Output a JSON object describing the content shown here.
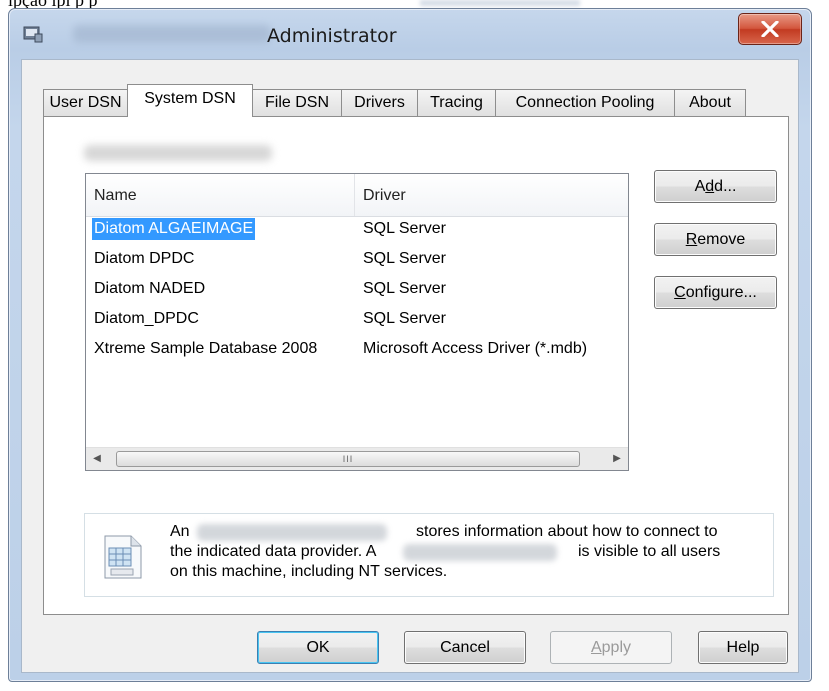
{
  "top_strip_text": "ı̂pção ipl̂ p p̂",
  "window": {
    "title_suffix": "Administrator",
    "close_icon": "close-x-icon",
    "app_icon": "odbc-app-icon"
  },
  "tabs": [
    {
      "label": "User DSN",
      "active": false
    },
    {
      "label": "System DSN",
      "active": true
    },
    {
      "label": "File DSN",
      "active": false
    },
    {
      "label": "Drivers",
      "active": false
    },
    {
      "label": "Tracing",
      "active": false
    },
    {
      "label": "Connection Pooling",
      "active": false
    },
    {
      "label": "About",
      "active": false
    }
  ],
  "list": {
    "columns": [
      "Name",
      "Driver"
    ],
    "rows": [
      {
        "name": "Diatom ALGAEIMAGE",
        "driver": "SQL Server",
        "selected": true
      },
      {
        "name": "Diatom DPDC",
        "driver": "SQL Server",
        "selected": false
      },
      {
        "name": "Diatom NADED",
        "driver": "SQL Server",
        "selected": false
      },
      {
        "name": "Diatom_DPDC",
        "driver": "SQL Server",
        "selected": false
      },
      {
        "name": "Xtreme Sample Database 2008",
        "driver": "Microsoft Access Driver (*.mdb)",
        "selected": false
      }
    ],
    "scroll_left_icon": "scroll-left-icon",
    "scroll_right_icon": "scroll-right-icon",
    "scroll_grip": "III"
  },
  "side_buttons": {
    "add": {
      "pre": "A",
      "acc": "d",
      "post": "d..."
    },
    "remove": {
      "pre": "",
      "acc": "R",
      "post": "emove"
    },
    "configure": {
      "pre": "",
      "acc": "C",
      "post": "onfigure..."
    }
  },
  "info": {
    "icon": "data-source-icon",
    "line1_a": "An",
    "line1_b": "stores information about how to connect to",
    "line2_a": "the indicated data provider.   A",
    "line2_b": "is visible to all users",
    "line3": "on this machine, including NT services."
  },
  "bottom_buttons": {
    "ok": "OK",
    "cancel": "Cancel",
    "apply": {
      "acc": "A",
      "post": "pply"
    },
    "help": "Help"
  }
}
